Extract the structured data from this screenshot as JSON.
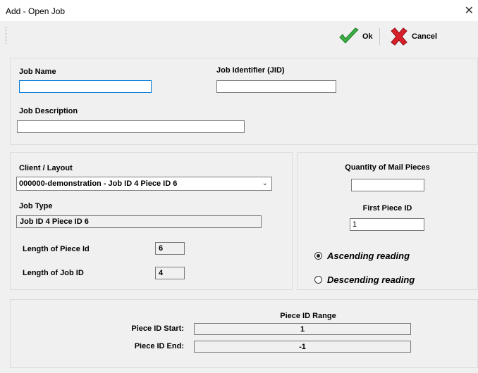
{
  "window": {
    "title": "Add - Open Job",
    "close_glyph": "✕"
  },
  "toolbar": {
    "ok_label": "Ok",
    "cancel_label": "Cancel"
  },
  "job": {
    "name_label": "Job Name",
    "name_value": "",
    "jid_label": "Job Identifier (JID)",
    "jid_value": "",
    "description_label": "Job Description",
    "description_value": ""
  },
  "client": {
    "client_layout_label": "Client / Layout",
    "client_layout_value": "000000-demonstration - Job ID 4 Piece ID 6",
    "job_type_label": "Job Type",
    "job_type_value": "Job ID 4 Piece ID 6",
    "piece_id_length_label": "Length of Piece Id",
    "piece_id_length_value": "6",
    "job_id_length_label": "Length of Job ID",
    "job_id_length_value": "4"
  },
  "quantity": {
    "mail_pieces_label": "Quantity of Mail Pieces",
    "mail_pieces_value": "",
    "first_piece_label": "First Piece ID",
    "first_piece_value": "1",
    "ascending_label": "Ascending reading",
    "ascending_selected": true,
    "descending_label": "Descending reading",
    "descending_selected": false
  },
  "range": {
    "title": "Piece ID Range",
    "start_label": "Piece ID  Start:",
    "start_value": "1",
    "end_label": "Piece ID End:",
    "end_value": "-1"
  },
  "icons": {
    "ok": "green-checkmark-icon",
    "cancel": "red-x-icon"
  },
  "colors": {
    "focus_border": "#0078d7",
    "ok_green": "#3cb043",
    "cancel_red": "#d9202a"
  }
}
